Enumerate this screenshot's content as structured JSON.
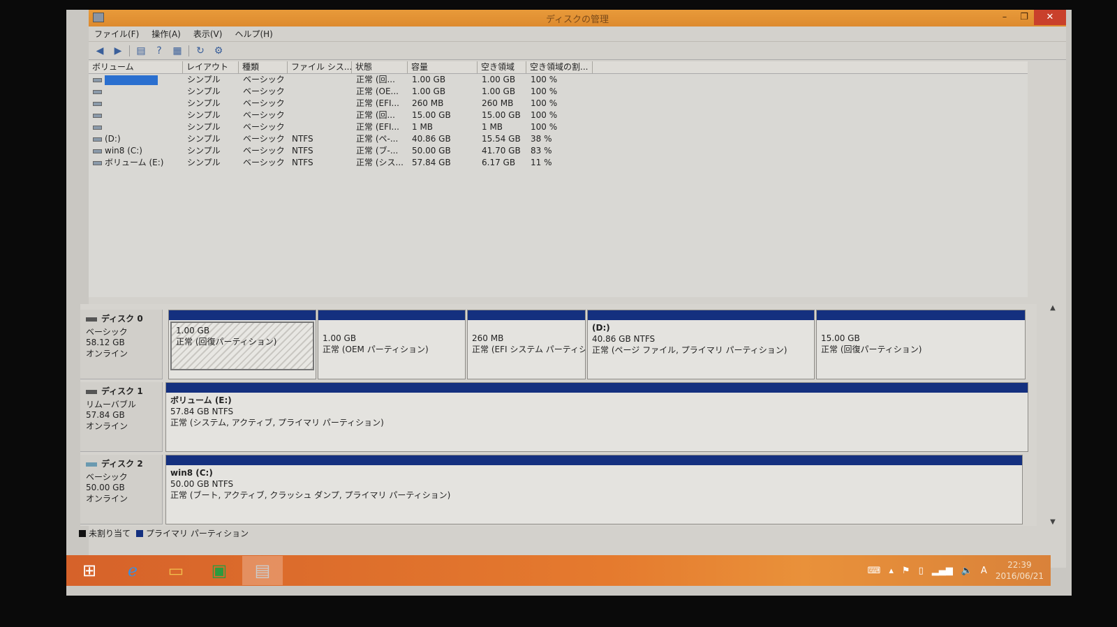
{
  "window": {
    "title": "ディスクの管理",
    "minimize": "–",
    "restore": "❐",
    "close": "✕"
  },
  "menu": [
    "ファイル(F)",
    "操作(A)",
    "表示(V)",
    "ヘルプ(H)"
  ],
  "toolbar_icons": [
    "back-arrow-icon",
    "forward-arrow-icon",
    "console-tree-icon",
    "help-icon",
    "properties-icon",
    "refresh-icon",
    "settings-icon"
  ],
  "volumes": {
    "columns": [
      "ボリューム",
      "レイアウト",
      "種類",
      "ファイル シス...",
      "状態",
      "容量",
      "空き領域",
      "空き領域の割..."
    ],
    "rows": [
      {
        "name": "",
        "layout": "シンプル",
        "type": "ベーシック",
        "fs": "",
        "status": "正常 (回...",
        "capacity": "1.00 GB",
        "free": "1.00 GB",
        "pct": "100 %"
      },
      {
        "name": "",
        "layout": "シンプル",
        "type": "ベーシック",
        "fs": "",
        "status": "正常 (OE...",
        "capacity": "1.00 GB",
        "free": "1.00 GB",
        "pct": "100 %"
      },
      {
        "name": "",
        "layout": "シンプル",
        "type": "ベーシック",
        "fs": "",
        "status": "正常 (EFI...",
        "capacity": "260 MB",
        "free": "260 MB",
        "pct": "100 %"
      },
      {
        "name": "",
        "layout": "シンプル",
        "type": "ベーシック",
        "fs": "",
        "status": "正常 (回...",
        "capacity": "15.00 GB",
        "free": "15.00 GB",
        "pct": "100 %"
      },
      {
        "name": "",
        "layout": "シンプル",
        "type": "ベーシック",
        "fs": "",
        "status": "正常 (EFI...",
        "capacity": "1 MB",
        "free": "1 MB",
        "pct": "100 %"
      },
      {
        "name": "(D:)",
        "layout": "シンプル",
        "type": "ベーシック",
        "fs": "NTFS",
        "status": "正常 (ペ-...",
        "capacity": "40.86 GB",
        "free": "15.54 GB",
        "pct": "38 %"
      },
      {
        "name": "win8 (C:)",
        "layout": "シンプル",
        "type": "ベーシック",
        "fs": "NTFS",
        "status": "正常 (ブ-...",
        "capacity": "50.00 GB",
        "free": "41.70 GB",
        "pct": "83 %"
      },
      {
        "name": "ボリューム (E:)",
        "layout": "シンプル",
        "type": "ベーシック",
        "fs": "NTFS",
        "status": "正常 (シス...",
        "capacity": "57.84 GB",
        "free": "6.17 GB",
        "pct": "11 %"
      }
    ]
  },
  "disks": [
    {
      "name": "ディスク 0",
      "kind": "ベーシック",
      "size": "58.12 GB",
      "state": "オンライン",
      "partitions": [
        {
          "title": "",
          "size": "1.00 GB",
          "status": "正常 (回復パーティション)"
        },
        {
          "title": "",
          "size": "1.00 GB",
          "status": "正常 (OEM パーティション)"
        },
        {
          "title": "",
          "size": "260 MB",
          "status": "正常 (EFI システム パーティシ"
        },
        {
          "title": "(D:)",
          "size": "40.86 GB NTFS",
          "status": "正常 (ページ ファイル, プライマリ パーティション)"
        },
        {
          "title": "",
          "size": "15.00 GB",
          "status": "正常 (回復パーティション)"
        }
      ]
    },
    {
      "name": "ディスク 1",
      "kind": "リムーバブル",
      "size": "57.84 GB",
      "state": "オンライン",
      "partitions": [
        {
          "title": "ボリューム (E:)",
          "size": "57.84 GB NTFS",
          "status": "正常 (システム, アクティブ, プライマリ パーティション)"
        }
      ]
    },
    {
      "name": "ディスク 2",
      "kind": "ベーシック",
      "size": "50.00 GB",
      "state": "オンライン",
      "partitions": [
        {
          "title": "win8 (C:)",
          "size": "50.00 GB NTFS",
          "status": "正常 (ブート, アクティブ, クラッシュ ダンプ, プライマリ パーティション)"
        }
      ]
    }
  ],
  "legend": {
    "unallocated": "未割り当て",
    "primary": "プライマリ パーティション",
    "unallocated_color": "#111111",
    "primary_color": "#14307f"
  },
  "taskbar": {
    "apps": [
      "start-icon",
      "internet-explorer-icon",
      "file-explorer-icon",
      "store-icon",
      "disk-management-icon"
    ],
    "ime": "A",
    "time": "22:39",
    "date": "2016/06/21"
  }
}
